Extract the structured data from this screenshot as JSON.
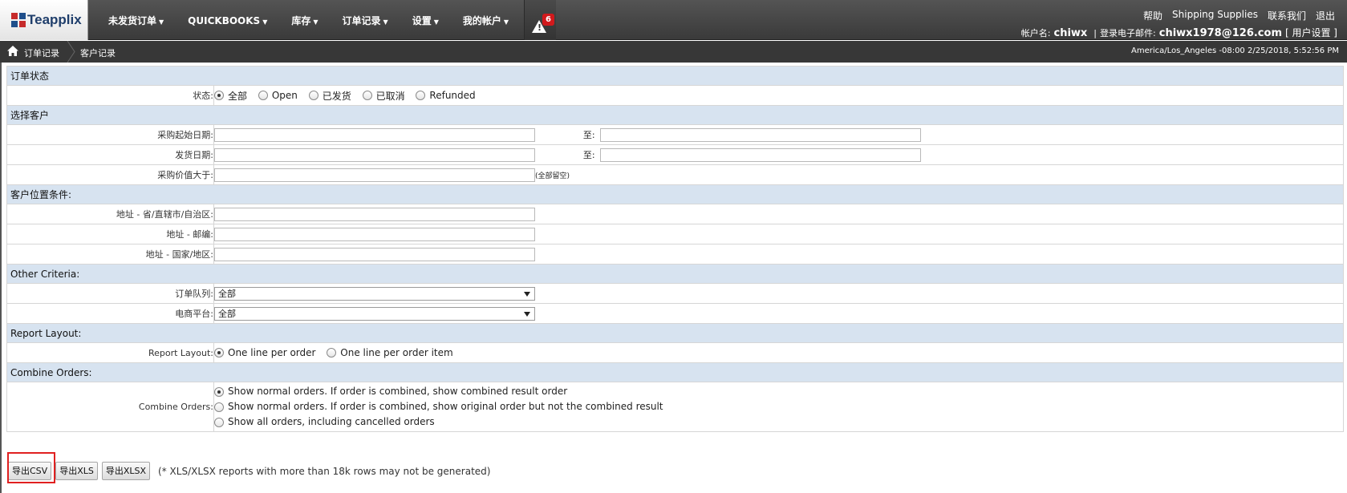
{
  "app": {
    "logo_text": "Teapplix",
    "brand_colors": {
      "red": "#c62b2b",
      "blue": "#1f4f8b"
    }
  },
  "nav": {
    "items": [
      {
        "label": "未发货订单"
      },
      {
        "label": "QUICKBOOKS"
      },
      {
        "label": "库存"
      },
      {
        "label": "订单记录"
      },
      {
        "label": "设置"
      },
      {
        "label": "我的帐户"
      }
    ],
    "alert_count": "6"
  },
  "top_links": {
    "help": "帮助",
    "shipping": "Shipping Supplies",
    "contact": "联系我们",
    "logout": "退出"
  },
  "account": {
    "name_label": "帐户名:",
    "name_value": "chiwx",
    "separator": "|",
    "email_label": "登录电子邮件:",
    "email_value": "chiwx1978@126.com",
    "settings_link": "[ 用户设置 ]"
  },
  "breadcrumb": {
    "item1": "订单记录",
    "item2": "客户记录",
    "timestamp": "America/Los_Angeles -08:00 2/25/2018, 5:52:56 PM"
  },
  "form": {
    "order_status": {
      "section": "订单状态",
      "label": "状态:",
      "options": [
        "全部",
        "Open",
        "已发货",
        "已取消",
        "Refunded"
      ],
      "selected": "全部"
    },
    "select_customer": {
      "section": "选择客户",
      "purchase_date_label": "采购起始日期:",
      "purchase_date_to": "至:",
      "ship_date_label": "发货日期:",
      "ship_date_to": "至:",
      "value_label": "采购价值大于:",
      "value_hint": "(全部留空)"
    },
    "location": {
      "section": "客户位置条件:",
      "state_label": "地址 - 省/直辖市/自治区:",
      "zip_label": "地址 - 邮编:",
      "country_label": "地址 - 国家/地区:"
    },
    "other": {
      "section": "Other Criteria:",
      "queue_label": "订单队列:",
      "queue_value": "全部",
      "platform_label": "电商平台:",
      "platform_value": "全部"
    },
    "report_layout": {
      "section": "Report Layout:",
      "label": "Report Layout:",
      "options": [
        "One line per order",
        "One line per order item"
      ],
      "selected": "One line per order"
    },
    "combine": {
      "section": "Combine Orders:",
      "label": "Combine Orders:",
      "options": [
        "Show normal orders. If order is combined, show combined result order",
        "Show normal orders. If order is combined, show original order but not the combined result",
        "Show all orders, including cancelled orders"
      ],
      "selected_index": 0
    }
  },
  "buttons": {
    "csv": "导出CSV",
    "xls": "导出XLS",
    "xlsx": "导出XLSX",
    "note": "(* XLS/XLSX reports with more than 18k rows may not be generated)"
  }
}
